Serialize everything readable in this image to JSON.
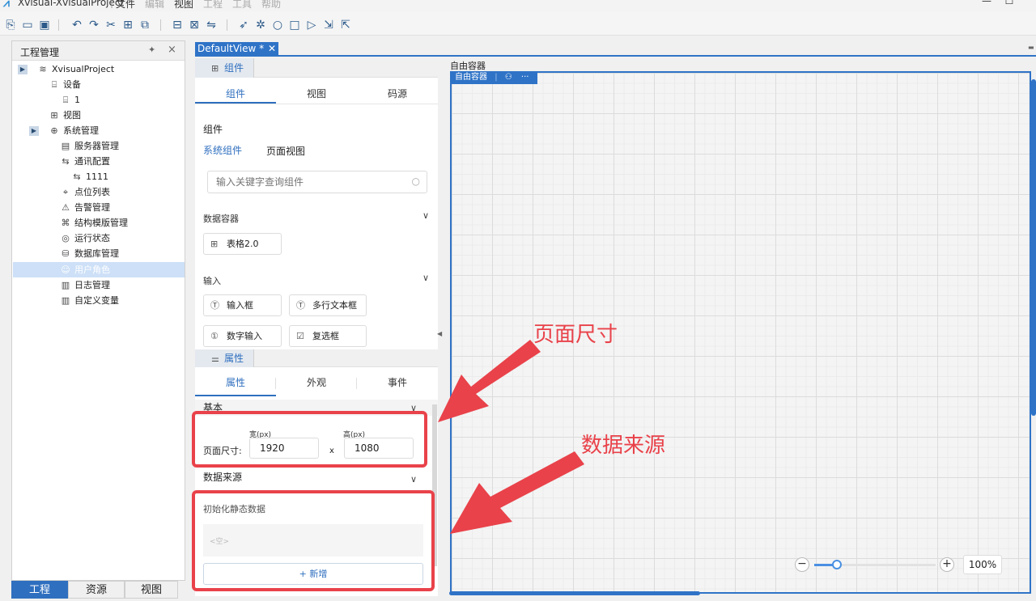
{
  "window": {
    "title": "Xvisual-XvisualProject",
    "menu": [
      "文件",
      "编辑",
      "视图",
      "工程",
      "工具",
      "帮助"
    ]
  },
  "toolbar_icons": [
    "new-page-icon",
    "open-folder-icon",
    "save-icon",
    "undo-icon",
    "redo-icon",
    "cut-icon",
    "copy-icon",
    "paste-icon",
    "component-icon",
    "group-icon",
    "connect-icon",
    "send-icon",
    "debug-icon",
    "refresh-icon",
    "stop-icon",
    "run-icon",
    "export-icon",
    "import-icon"
  ],
  "project_panel": {
    "title": "工程管理",
    "items": [
      {
        "label": "XvisualProject",
        "icon": "layers-icon",
        "level": 0
      },
      {
        "label": "设备",
        "icon": "device-icon",
        "level": 1
      },
      {
        "label": "1",
        "icon": "device-icon",
        "level": 2
      },
      {
        "label": "视图",
        "icon": "view-icon",
        "level": 1
      },
      {
        "label": "系统管理",
        "icon": "globe-icon",
        "level": 1
      },
      {
        "label": "服务器管理",
        "icon": "server-icon",
        "level": 2
      },
      {
        "label": "通讯配置",
        "icon": "link-icon",
        "level": 2
      },
      {
        "label": "1111",
        "icon": "link-icon",
        "level": 3
      },
      {
        "label": "点位列表",
        "icon": "pin-icon",
        "level": 2
      },
      {
        "label": "告警管理",
        "icon": "warning-icon",
        "level": 2
      },
      {
        "label": "结构模版管理",
        "icon": "template-icon",
        "level": 2
      },
      {
        "label": "运行状态",
        "icon": "status-icon",
        "level": 2
      },
      {
        "label": "数据库管理",
        "icon": "database-icon",
        "level": 2
      },
      {
        "label": "用户角色",
        "icon": "user-icon",
        "level": 2
      },
      {
        "label": "日志管理",
        "icon": "log-icon",
        "level": 2
      },
      {
        "label": "自定义变量",
        "icon": "variable-icon",
        "level": 2
      }
    ],
    "bottom_tabs": [
      "工程",
      "资源",
      "视图"
    ]
  },
  "doc_tab": {
    "label": "DefaultView *"
  },
  "component_panel": {
    "band_label": "组件",
    "tabs": [
      "组件",
      "视图",
      "码源"
    ],
    "section_title": "组件",
    "sub_tabs": [
      "系统组件",
      "页面视图"
    ],
    "search_placeholder": "输入关键字查询组件",
    "groups": [
      {
        "name": "数据容器",
        "items": [
          "表格2.0"
        ]
      },
      {
        "name": "输入",
        "items": [
          "输入框",
          "多行文本框",
          "数字输入",
          "复选框"
        ]
      }
    ]
  },
  "property_panel": {
    "band_label": "属性",
    "tabs": [
      "属性",
      "外观",
      "事件"
    ],
    "basic_label": "基本",
    "page_size_label": "页面尺寸:",
    "width_label": "宽(px)",
    "height_label": "高(px)",
    "width_value": "1920",
    "height_value": "1080",
    "times": "x",
    "data_source_label": "数据来源",
    "init_static_label": "初始化静态数据",
    "empty_text": "<空>",
    "add_button": "+ 新增"
  },
  "canvas": {
    "label": "自由容器",
    "tag_label": "自由容器",
    "tag_more": "···"
  },
  "zoom": {
    "value": "100%",
    "level": 0.15
  },
  "annotations": {
    "page_size": "页面尺寸",
    "data_source": "数据来源",
    "color": "#e9424a"
  },
  "colors": {
    "accent": "#2f73c7",
    "selected_row": "#cde0f7"
  }
}
